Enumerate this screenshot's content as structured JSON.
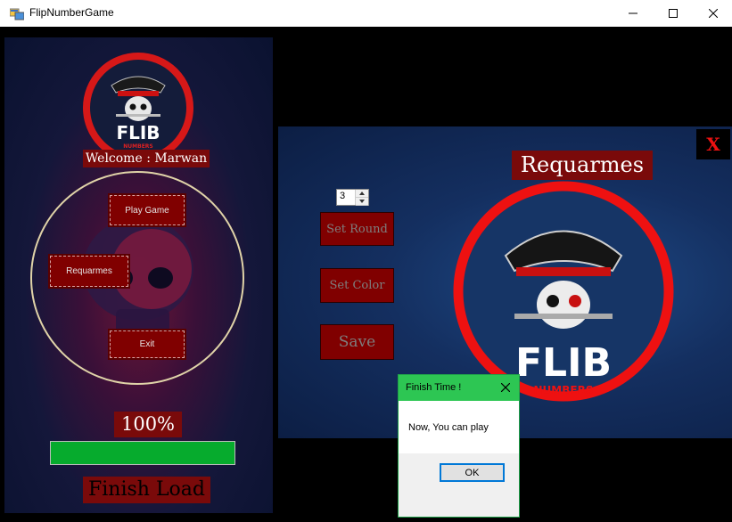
{
  "window": {
    "title": "FlipNumberGame"
  },
  "left_panel": {
    "logo": {
      "text": "FLIB",
      "subtext": "NUMBERS"
    },
    "welcome": "Welcome : Marwan",
    "buttons": {
      "play": "Play Game",
      "requarmes": "Requarmes",
      "exit": "Exit"
    },
    "progress_text": "100%",
    "progress_value": 100,
    "status": "Finish Load"
  },
  "requarmes_panel": {
    "close_label": "X",
    "title": "Requarmes",
    "round_value": "3",
    "buttons": {
      "set_round": "Set Round",
      "set_color": "Set Color",
      "save": "Save"
    },
    "logo": {
      "text": "FLIB",
      "subtext": "NUMBERS"
    }
  },
  "dialog": {
    "title": "Finish Time !",
    "message": "Now, You can play",
    "ok": "OK"
  },
  "colors": {
    "accent_red": "#800000",
    "progress_green": "#06ab2d",
    "dialog_title": "#2dc653"
  }
}
